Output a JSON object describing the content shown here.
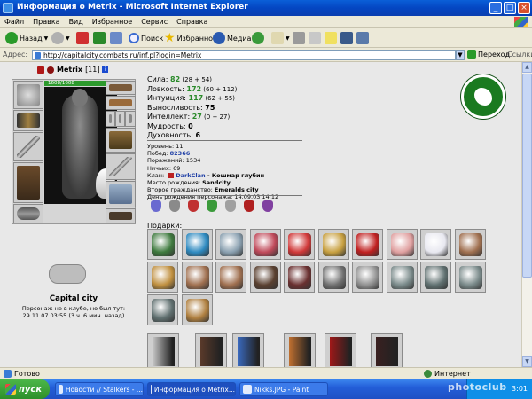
{
  "window": {
    "title": "Информация о Metrix - Microsoft Internet Explorer",
    "min": "_",
    "max": "□",
    "close": "×"
  },
  "menu": [
    "Файл",
    "Правка",
    "Вид",
    "Избранное",
    "Сервис",
    "Справка"
  ],
  "toolbar": {
    "back": "Назад",
    "search": "Поиск",
    "favorites": "Избранное",
    "media": "Медиа"
  },
  "address": {
    "label": "Адрес:",
    "url": "http://capitalcity.combats.ru/inf.pl?login=Metrix",
    "go": "Переход",
    "links": "Ссылки"
  },
  "character": {
    "name": "Metrix",
    "level_tag": "[11]",
    "info_icon": "i",
    "hp": "1608/1608",
    "city": "Capital city",
    "presence": "Персонаж не в клубе, но был тут:",
    "last_seen": "29.11.07 03:55 (3 ч. 6 мин. назад)"
  },
  "stats": [
    {
      "label": "Сила: ",
      "value": "82",
      "extra": " (28 + 54)",
      "color": "green"
    },
    {
      "label": "Ловкость: ",
      "value": "172",
      "extra": " (60 + 112)",
      "color": "green"
    },
    {
      "label": "Интуиция: ",
      "value": "117",
      "extra": " (62 + 55)",
      "color": "green"
    },
    {
      "label": "Выносливость: ",
      "value": "75",
      "extra": "",
      "color": "black"
    },
    {
      "label": "Интеллект: ",
      "value": "27",
      "extra": " (0 + 27)",
      "color": "green"
    },
    {
      "label": "Мудрость: ",
      "value": "0",
      "extra": "",
      "color": "black"
    },
    {
      "label": "Духовность: ",
      "value": "6",
      "extra": "",
      "color": "black"
    }
  ],
  "info": {
    "level_label": "Уровень: ",
    "level": "11",
    "wins_label": "Побед: ",
    "wins": "82366",
    "losses_label": "Поражений: ",
    "losses": "1534",
    "draws_label": "Ничьих: ",
    "draws": "69",
    "clan_label": "Клан: ",
    "clan": "DarkClan",
    "clan_rank": " - Кошмар глубин",
    "birthplace_label": "Место рождения: ",
    "birthplace": "Sandcity",
    "citizenship_label": "Второе гражданство: ",
    "citizenship": "Emeralds city",
    "birthday_label": "День рождения персонажа: ",
    "birthday": "14.09.03 14:12"
  },
  "gifts_title": "Подарки:",
  "badge_colors": [
    "#6a6ad0",
    "#8a8a8a",
    "#c03030",
    "#3a9a3a",
    "#a0a0a0",
    "#b02020",
    "#8040a0"
  ],
  "gift_colors": [
    "#3e7a3e",
    "#2e8ac0",
    "#8aa0b0",
    "#c04a5a",
    "#d03838",
    "#c8a040",
    "#c02020",
    "#e0a0a0",
    "#e8e8f0",
    "#a07050",
    "#c09040",
    "#a07050",
    "#a07050",
    "#5a4030",
    "#6a3030",
    "#707070",
    "#909090",
    "#7a8a8a",
    "#607070",
    "#7a8a8a",
    "#607070",
    "#b08040"
  ],
  "book_colors": [
    "#c8c8c8",
    "#5a3a2a",
    "#3a6ac0",
    "#c07030",
    "#a01818",
    "#3a2020"
  ],
  "status": {
    "done": "Готово",
    "zone": "Интернет"
  },
  "taskbar": {
    "start": "пуск",
    "tasks": [
      "Новости // Stalkers - ...",
      "Информация о Metrix...",
      "Nikks.JPG - Paint"
    ],
    "clock": "3:01",
    "watermark": "photoclub"
  }
}
